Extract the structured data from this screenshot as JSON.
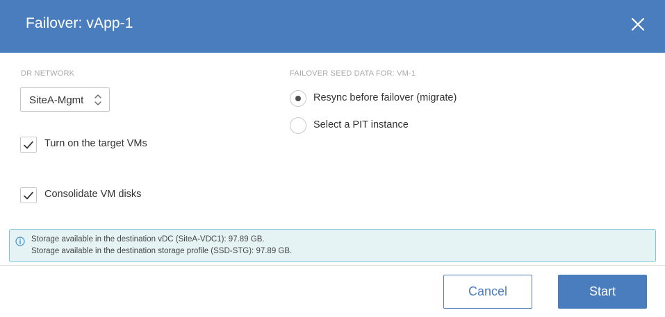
{
  "dialog": {
    "title": "Failover: vApp-1",
    "close_icon": "close-icon",
    "header_color": "#4a7dbd"
  },
  "dr_network": {
    "label": "DR NETWORK",
    "selected_value": "SiteA-Mgmt",
    "icon": "select-arrows-icon"
  },
  "options": {
    "turn_on_target_vms": {
      "label": "Turn on the target VMs",
      "checked": true
    },
    "consolidate_vm_disks": {
      "label": "Consolidate VM disks",
      "checked": true
    }
  },
  "seed_data": {
    "label": "FAILOVER SEED DATA FOR: VM-1",
    "choices": [
      {
        "label": "Resync before failover (migrate)",
        "selected": true
      },
      {
        "label": "Select a PIT instance",
        "selected": false
      }
    ]
  },
  "info": {
    "icon": "info-icon",
    "lines": [
      "Storage available in the destination vDC (SiteA-VDC1): 97.89 GB.",
      "Storage available in the destination storage profile (SSD-STG): 97.89 GB."
    ],
    "border_color": "#7ec8d3",
    "background_color": "#e6f3f5"
  },
  "footer": {
    "cancel_label": "Cancel",
    "start_label": "Start",
    "accent": "#4a7dbd"
  }
}
